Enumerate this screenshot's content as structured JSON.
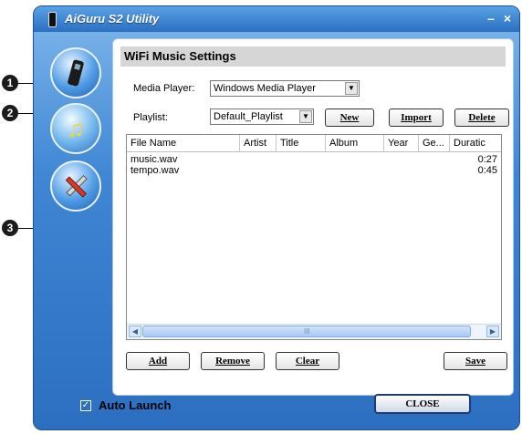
{
  "window": {
    "title": "AiGuru S2 Utility",
    "minimize_glyph": "–",
    "close_glyph": "×"
  },
  "nav": [
    {
      "name": "device-icon"
    },
    {
      "name": "music-icon"
    },
    {
      "name": "tools-icon"
    }
  ],
  "callouts": [
    "1",
    "2",
    "3"
  ],
  "panel": {
    "title": "WiFi Music Settings",
    "media_player_label": "Media Player:",
    "media_player_value": "Windows Media Player",
    "playlist_label": "Playlist:",
    "playlist_value": "Default_Playlist",
    "new_label": "New",
    "import_label": "Import",
    "delete_label": "Delete"
  },
  "list": {
    "columns": [
      "File Name",
      "Artist",
      "Title",
      "Album",
      "Year",
      "Ge...",
      "Duratic"
    ],
    "rows": [
      {
        "file": "music.wav",
        "duration": "0:27"
      },
      {
        "file": "tempo.wav",
        "duration": "0:45"
      }
    ],
    "scroll_grip": "III"
  },
  "actions": {
    "add_label": "Add",
    "remove_label": "Remove",
    "clear_label": "Clear",
    "save_label": "Save"
  },
  "footer": {
    "auto_launch_label": "Auto Launch",
    "auto_launch_checked": true,
    "close_label": "CLOSE"
  }
}
